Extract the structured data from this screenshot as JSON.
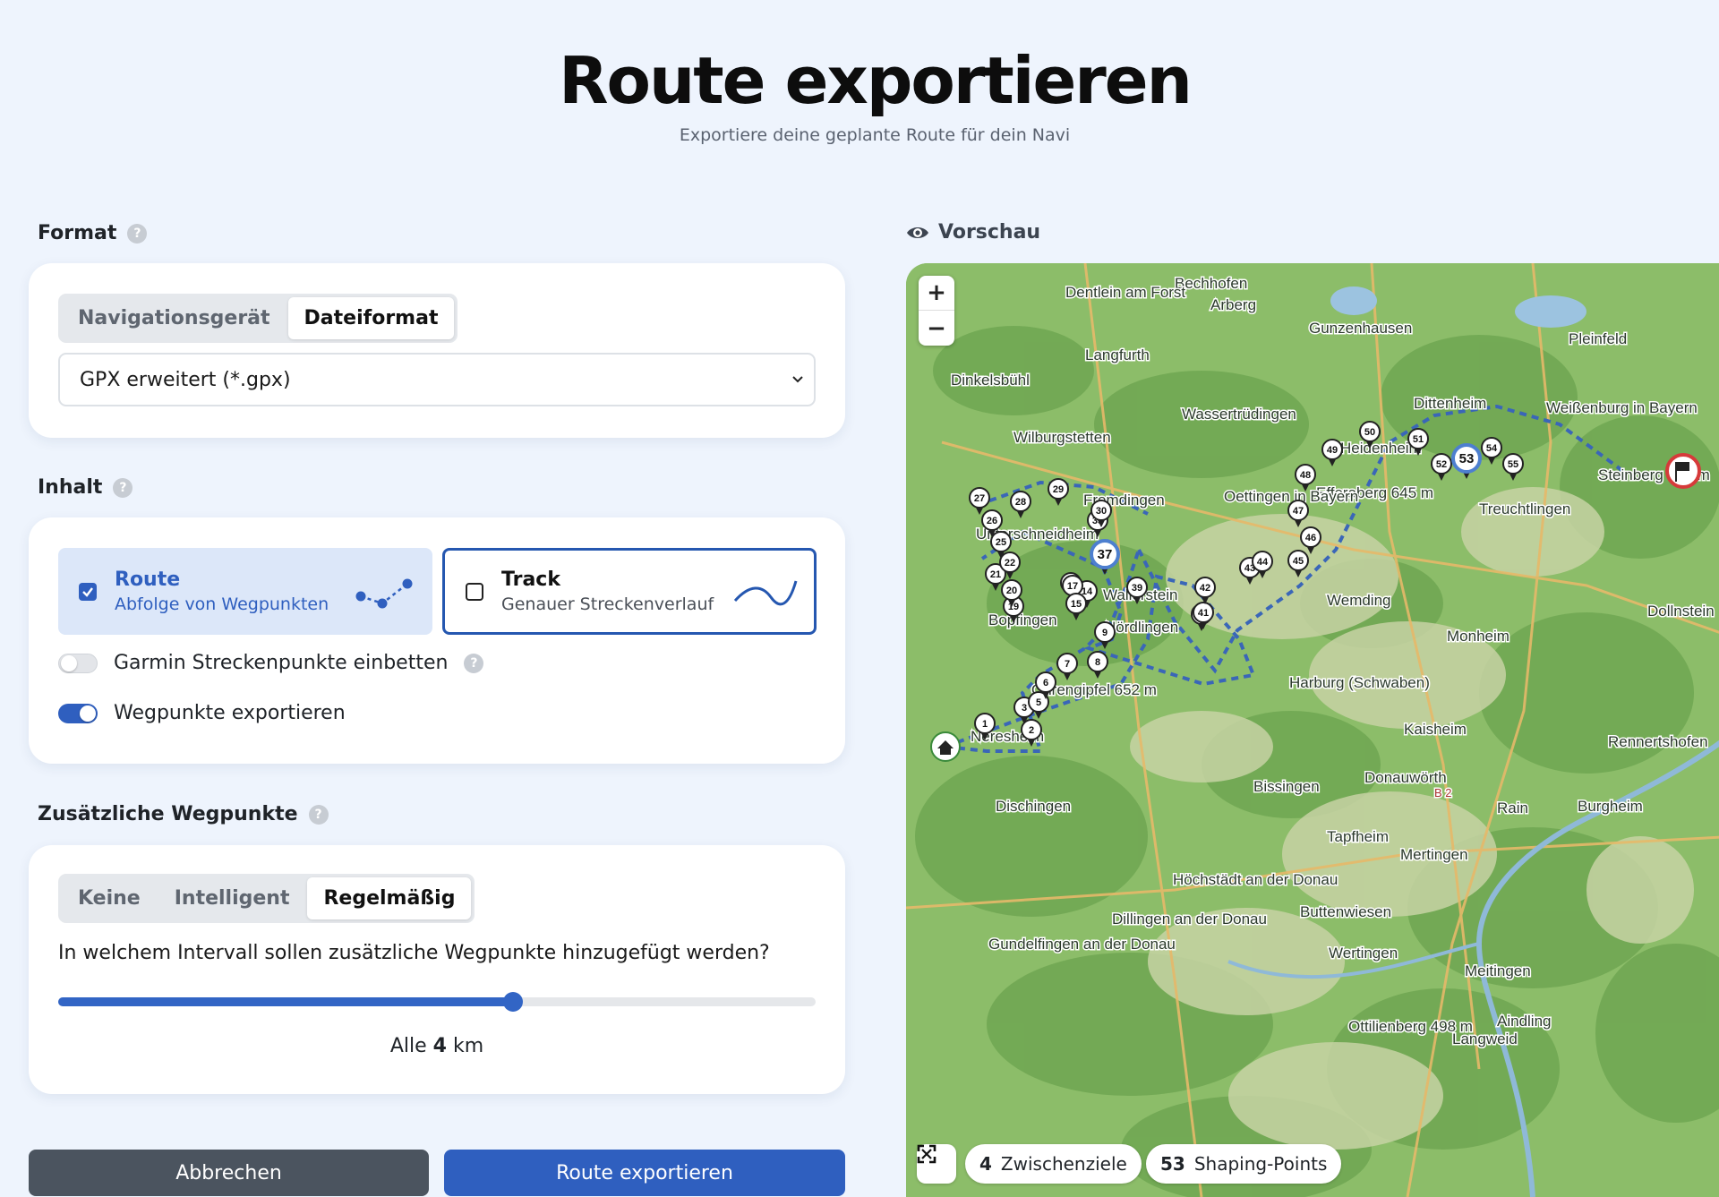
{
  "header": {
    "title": "Route exportieren",
    "subtitle": "Exportiere deine geplante Route für dein Navi"
  },
  "format": {
    "label": "Format",
    "tabs": [
      "Navigationsgerät",
      "Dateiformat"
    ],
    "active_tab": "Dateiformat",
    "selected": "GPX erweitert (*.gpx)"
  },
  "content": {
    "label": "Inhalt",
    "route": {
      "title": "Route",
      "subtitle": "Abfolge von Wegpunkten",
      "checked": true
    },
    "track": {
      "title": "Track",
      "subtitle": "Genauer Streckenverlauf",
      "checked": false
    },
    "garmin_toggle": {
      "label": "Garmin Streckenpunkte einbetten",
      "on": false
    },
    "waypoints_toggle": {
      "label": "Wegpunkte exportieren",
      "on": true
    }
  },
  "extra": {
    "label": "Zusätzliche Wegpunkte",
    "tabs": [
      "Keine",
      "Intelligent",
      "Regelmäßig"
    ],
    "active_tab": "Regelmäßig",
    "question": "In welchem Intervall sollen zusätzliche Wegpunkte hinzugefügt werden?",
    "slider_fraction": 0.6,
    "readout_prefix": "Alle",
    "readout_value": "4",
    "readout_unit": "km"
  },
  "actions": {
    "cancel": "Abbrechen",
    "export": "Route exportieren"
  },
  "preview": {
    "label": "Vorschau",
    "zoom_in": "+",
    "zoom_out": "−",
    "stops_count": "4",
    "stops_label": "Zwischenziele",
    "shaping_count": "53",
    "shaping_label": "Shaping-Points",
    "place_labels": [
      "Bechhofen",
      "Dentlein am Forst",
      "Arberg",
      "Gunzenhausen",
      "Pleinfeld",
      "Langfurth",
      "Dinkelsbühl",
      "Wassertrüdingen",
      "Dittenheim",
      "Weißenburg in Bayern",
      "Wilburgstetten",
      "Heidenheim",
      "Steinberg 625 m",
      "Efferaberg 645 m",
      "Fremdingen",
      "Oettingen in Bayern",
      "Treuchtlingen",
      "Unterschneidheim",
      "Wallerstein",
      "Nördlingen",
      "Wemding",
      "Dollnstein",
      "Monheim",
      "Bopfingen",
      "Ohrengipfel 652 m",
      "Harburg (Schwaben)",
      "Kaisheim",
      "Neresheim",
      "Rennertshofen",
      "Bissingen",
      "Donauwörth",
      "Dischingen",
      "Rain",
      "Burgheim",
      "Tapfheim",
      "Mertingen",
      "Höchstädt an der Donau",
      "Buttenwiesen",
      "Dillingen an der Donau",
      "Gundelfingen an der Donau",
      "Wertingen",
      "Meitingen",
      "Ottilienberg 498 m",
      "Aindling",
      "Langweid",
      "B 2"
    ]
  },
  "colors": {
    "accent": "#2f5fbf",
    "map_green": "#8bbf6a",
    "route_line": "#3a66b8"
  }
}
